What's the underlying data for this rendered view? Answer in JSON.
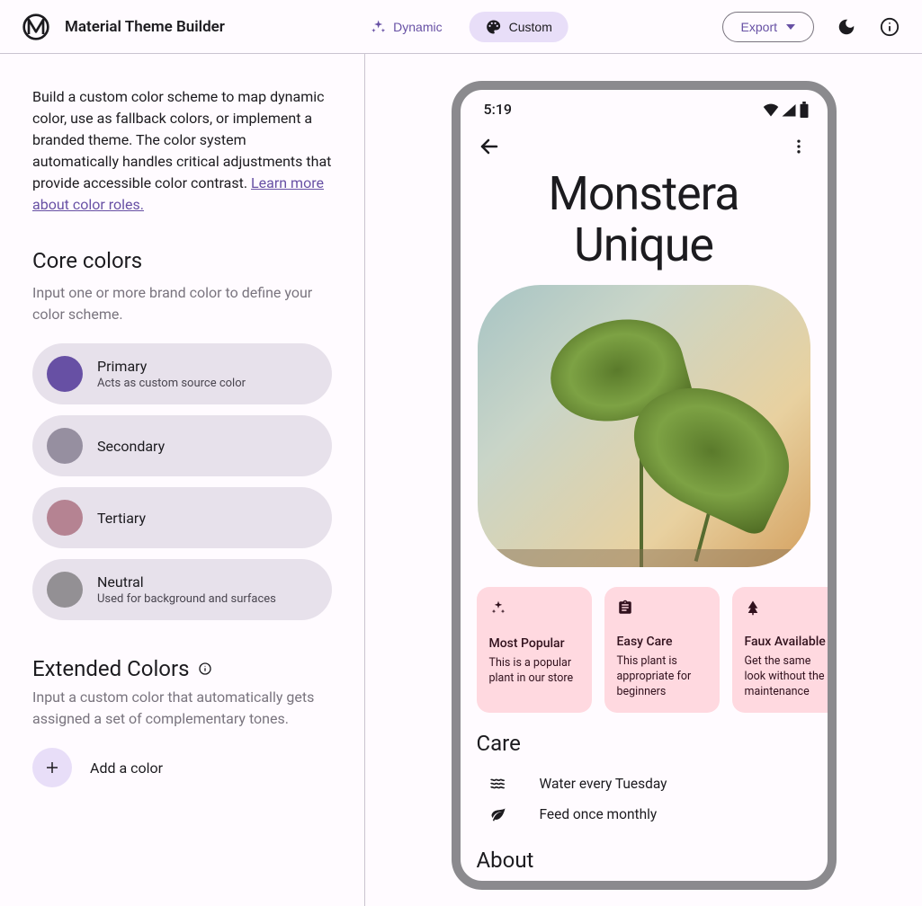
{
  "header": {
    "app_title": "Material Theme Builder",
    "tabs": {
      "dynamic": "Dynamic",
      "custom": "Custom"
    },
    "export": "Export"
  },
  "sidebar": {
    "intro_text": "Build a custom color scheme to map dynamic color, use as fallback colors, or implement a branded theme. The color system automatically handles critical adjustments that provide accessible color contrast. ",
    "intro_link": "Learn more about color roles.",
    "core_colors_title": "Core colors",
    "core_colors_sub": "Input one or more brand color to define your color scheme.",
    "colors": [
      {
        "label": "Primary",
        "sub": "Acts as custom source color",
        "hex": "#6750a4"
      },
      {
        "label": "Secondary",
        "sub": "",
        "hex": "#968fa0"
      },
      {
        "label": "Tertiary",
        "sub": "",
        "hex": "#b58392"
      },
      {
        "label": "Neutral",
        "sub": "Used for background and surfaces",
        "hex": "#939094"
      }
    ],
    "extended_title": "Extended Colors",
    "extended_sub": "Input a custom color that automatically gets assigned a set of complementary tones.",
    "add_label": "Add a color"
  },
  "preview": {
    "status_time": "5:19",
    "plant_name": "Monstera\nUnique",
    "features": [
      {
        "icon": "sparkle",
        "title": "Most Popular",
        "desc": "This is a popular plant in our store"
      },
      {
        "icon": "clipboard",
        "title": "Easy Care",
        "desc": "This plant is appropriate for beginners"
      },
      {
        "icon": "tree",
        "title": "Faux Available",
        "desc": "Get the same look without the maintenance"
      }
    ],
    "care_title": "Care",
    "care_items": [
      {
        "icon": "water",
        "label": "Water every Tuesday"
      },
      {
        "icon": "leaf",
        "label": "Feed once monthly"
      }
    ],
    "about_title": "About"
  }
}
